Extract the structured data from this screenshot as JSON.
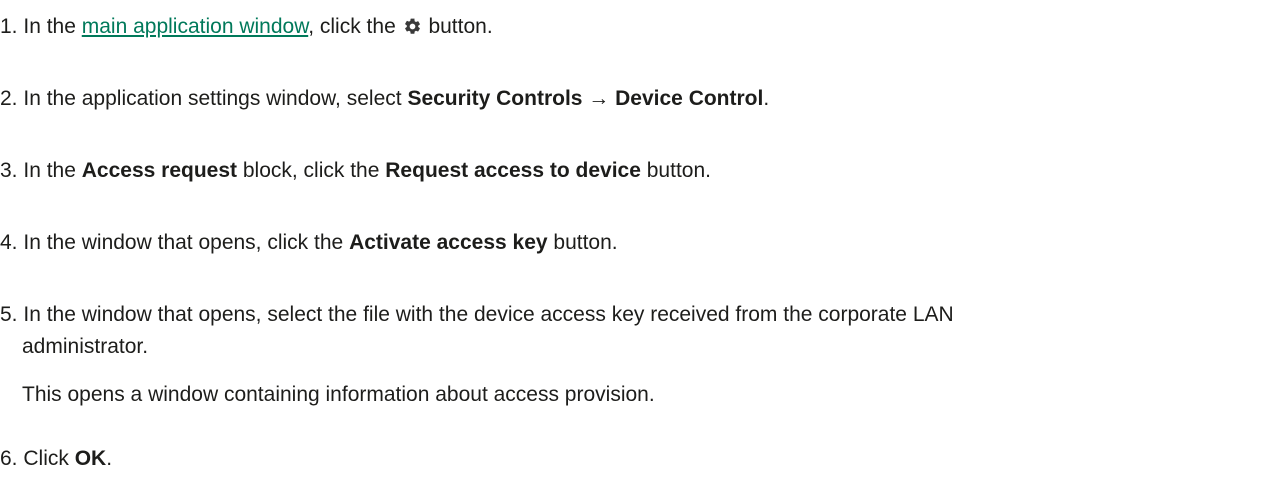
{
  "steps": [
    {
      "number": "1.",
      "text_before": "In the",
      "link_text": "main application window",
      "text_after": ", click the",
      "icon": "gear-icon",
      "text_end": "button."
    },
    {
      "number": "2.",
      "text_before": "In the application settings window, select",
      "bold": "Security Controls → Device Control",
      "text_after": "."
    },
    {
      "number": "3.",
      "text_before": "In the",
      "bold1": "Access request",
      "text_mid": "block, click the",
      "bold2": "Request access to device",
      "text_after": "button."
    },
    {
      "number": "4.",
      "text_before": "In the window that opens, click the",
      "bold": "Activate access key",
      "text_after": "button."
    },
    {
      "number": "5.",
      "line1": "In the window that opens, select the file with the device access key received from the corporate LAN",
      "line2": "administrator.",
      "note": "This opens a window containing information about access provision."
    },
    {
      "number": "6.",
      "text_before": "Click",
      "bold": "OK",
      "text_after": "."
    }
  ],
  "colors": {
    "text": "#1d1d1b",
    "link": "#00795a"
  }
}
